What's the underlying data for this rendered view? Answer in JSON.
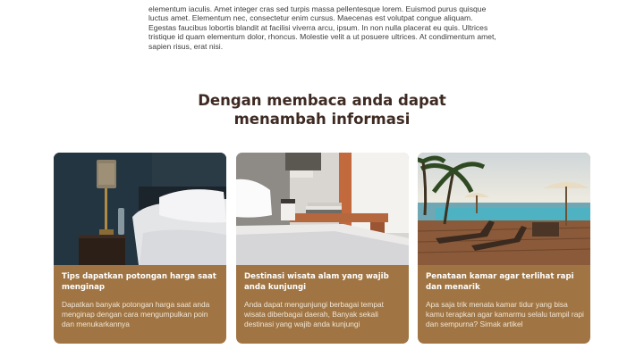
{
  "intro": {
    "paragraph": "elementum iaculis. Amet integer cras sed turpis massa pellentesque lorem. Euismod purus quisque luctus amet. Elementum nec, consectetur enim cursus. Maecenas est volutpat congue aliquam. Egestas faucibus lobortis blandit at facilisi viverra arcu, ipsum. In non nulla placerat eu quis. Ultrices tristique id quam elementum dolor, rhoncus. Molestie velit a ut posuere ultrices. At condimentum amet, sapien risus, erat nisi."
  },
  "section": {
    "title_line1": "Dengan membaca anda dapat",
    "title_line2": "menambah informasi"
  },
  "cards": [
    {
      "title": "Tips dapatkan potongan harga saat menginap",
      "text": "Dapatkan banyak potongan harga saat anda menginap dengan cara mengumpulkan poin dan menukarkannya"
    },
    {
      "title": "Destinasi wisata alam yang wajib anda kunjungi",
      "text": "Anda dapat mengunjungi berbagai tempat wisata diberbagai daerah, Banyak sekali destinasi yang wajib anda kunjungi"
    },
    {
      "title": "Penataan kamar agar terlihat rapi dan menarik",
      "text": "Apa saja trik menata kamar tidur yang bisa kamu terapkan agar kamarmu selalu tampil rapi dan sempurna? Simak artikel"
    }
  ],
  "colors": {
    "card_background": "#a07543",
    "heading": "#3e2a22",
    "body_text": "#3d3d3d"
  }
}
